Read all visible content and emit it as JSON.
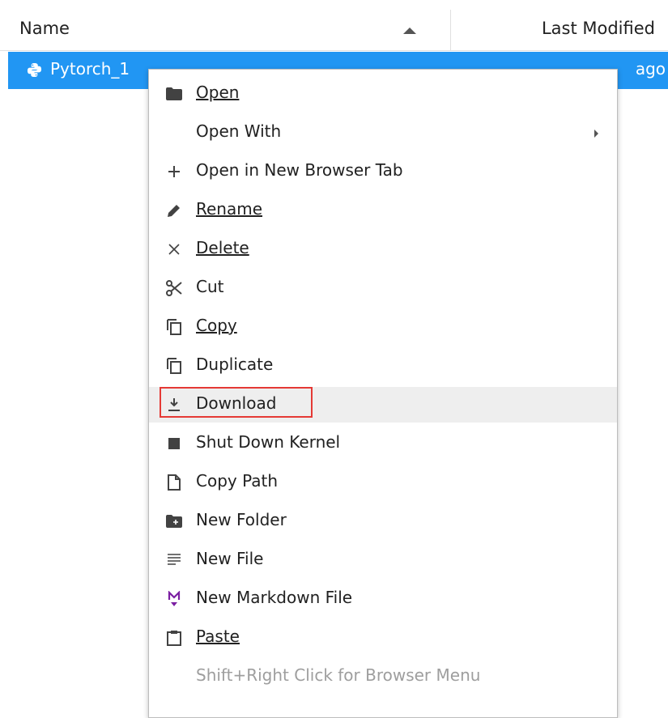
{
  "header": {
    "name_label": "Name",
    "modified_label": "Last Modified"
  },
  "file_row": {
    "name": "Pytorch_1",
    "modified": "ago",
    "icon": "python-icon"
  },
  "menu": {
    "items": [
      {
        "label": "Open",
        "icon": "folder-icon"
      },
      {
        "label": "Open With",
        "icon": "",
        "submenu": true
      },
      {
        "label": "Open in New Browser Tab",
        "icon": "plus-icon"
      },
      {
        "label": "Rename",
        "icon": "pencil-icon"
      },
      {
        "label": "Delete",
        "icon": "close-icon"
      },
      {
        "label": "Cut",
        "icon": "scissors-icon"
      },
      {
        "label": "Copy",
        "icon": "copy-icon"
      },
      {
        "label": "Duplicate",
        "icon": "copy-icon"
      },
      {
        "label": "Download",
        "icon": "download-icon",
        "active": true
      },
      {
        "label": "Shut Down Kernel",
        "icon": "stop-icon"
      },
      {
        "label": "Copy Path",
        "icon": "file-icon"
      },
      {
        "label": "New Folder",
        "icon": "new-folder-icon"
      },
      {
        "label": "New File",
        "icon": "text-file-icon"
      },
      {
        "label": "New Markdown File",
        "icon": "markdown-icon"
      },
      {
        "label": "Paste",
        "icon": "clipboard-icon"
      }
    ],
    "hint": "Shift+Right Click for Browser Menu"
  },
  "colors": {
    "selection": "#2196f3",
    "highlight_border": "#e53935",
    "markdown_icon": "#7b1fa2"
  }
}
